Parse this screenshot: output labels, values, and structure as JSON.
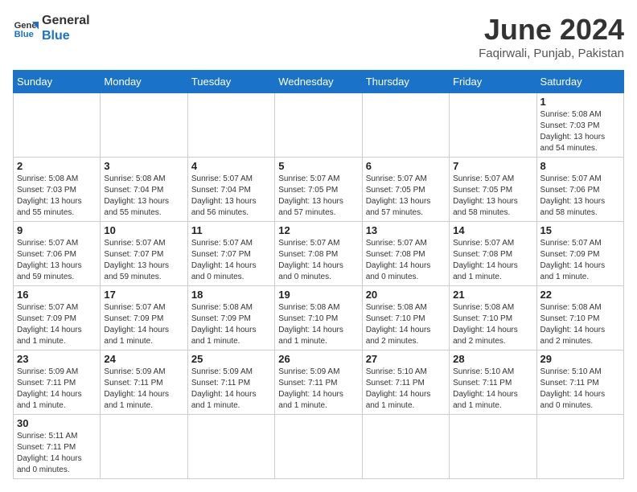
{
  "header": {
    "logo_general": "General",
    "logo_blue": "Blue",
    "title": "June 2024",
    "subtitle": "Faqirwali, Punjab, Pakistan"
  },
  "weekdays": [
    "Sunday",
    "Monday",
    "Tuesday",
    "Wednesday",
    "Thursday",
    "Friday",
    "Saturday"
  ],
  "weeks": [
    [
      {
        "day": "",
        "info": ""
      },
      {
        "day": "",
        "info": ""
      },
      {
        "day": "",
        "info": ""
      },
      {
        "day": "",
        "info": ""
      },
      {
        "day": "",
        "info": ""
      },
      {
        "day": "",
        "info": ""
      },
      {
        "day": "1",
        "info": "Sunrise: 5:08 AM\nSunset: 7:03 PM\nDaylight: 13 hours\nand 54 minutes."
      }
    ],
    [
      {
        "day": "2",
        "info": "Sunrise: 5:08 AM\nSunset: 7:03 PM\nDaylight: 13 hours\nand 55 minutes."
      },
      {
        "day": "3",
        "info": "Sunrise: 5:08 AM\nSunset: 7:04 PM\nDaylight: 13 hours\nand 55 minutes."
      },
      {
        "day": "4",
        "info": "Sunrise: 5:07 AM\nSunset: 7:04 PM\nDaylight: 13 hours\nand 56 minutes."
      },
      {
        "day": "5",
        "info": "Sunrise: 5:07 AM\nSunset: 7:05 PM\nDaylight: 13 hours\nand 57 minutes."
      },
      {
        "day": "6",
        "info": "Sunrise: 5:07 AM\nSunset: 7:05 PM\nDaylight: 13 hours\nand 57 minutes."
      },
      {
        "day": "7",
        "info": "Sunrise: 5:07 AM\nSunset: 7:05 PM\nDaylight: 13 hours\nand 58 minutes."
      },
      {
        "day": "8",
        "info": "Sunrise: 5:07 AM\nSunset: 7:06 PM\nDaylight: 13 hours\nand 58 minutes."
      }
    ],
    [
      {
        "day": "9",
        "info": "Sunrise: 5:07 AM\nSunset: 7:06 PM\nDaylight: 13 hours\nand 59 minutes."
      },
      {
        "day": "10",
        "info": "Sunrise: 5:07 AM\nSunset: 7:07 PM\nDaylight: 13 hours\nand 59 minutes."
      },
      {
        "day": "11",
        "info": "Sunrise: 5:07 AM\nSunset: 7:07 PM\nDaylight: 14 hours\nand 0 minutes."
      },
      {
        "day": "12",
        "info": "Sunrise: 5:07 AM\nSunset: 7:08 PM\nDaylight: 14 hours\nand 0 minutes."
      },
      {
        "day": "13",
        "info": "Sunrise: 5:07 AM\nSunset: 7:08 PM\nDaylight: 14 hours\nand 0 minutes."
      },
      {
        "day": "14",
        "info": "Sunrise: 5:07 AM\nSunset: 7:08 PM\nDaylight: 14 hours\nand 1 minute."
      },
      {
        "day": "15",
        "info": "Sunrise: 5:07 AM\nSunset: 7:09 PM\nDaylight: 14 hours\nand 1 minute."
      }
    ],
    [
      {
        "day": "16",
        "info": "Sunrise: 5:07 AM\nSunset: 7:09 PM\nDaylight: 14 hours\nand 1 minute."
      },
      {
        "day": "17",
        "info": "Sunrise: 5:07 AM\nSunset: 7:09 PM\nDaylight: 14 hours\nand 1 minute."
      },
      {
        "day": "18",
        "info": "Sunrise: 5:08 AM\nSunset: 7:09 PM\nDaylight: 14 hours\nand 1 minute."
      },
      {
        "day": "19",
        "info": "Sunrise: 5:08 AM\nSunset: 7:10 PM\nDaylight: 14 hours\nand 1 minute."
      },
      {
        "day": "20",
        "info": "Sunrise: 5:08 AM\nSunset: 7:10 PM\nDaylight: 14 hours\nand 2 minutes."
      },
      {
        "day": "21",
        "info": "Sunrise: 5:08 AM\nSunset: 7:10 PM\nDaylight: 14 hours\nand 2 minutes."
      },
      {
        "day": "22",
        "info": "Sunrise: 5:08 AM\nSunset: 7:10 PM\nDaylight: 14 hours\nand 2 minutes."
      }
    ],
    [
      {
        "day": "23",
        "info": "Sunrise: 5:09 AM\nSunset: 7:11 PM\nDaylight: 14 hours\nand 1 minute."
      },
      {
        "day": "24",
        "info": "Sunrise: 5:09 AM\nSunset: 7:11 PM\nDaylight: 14 hours\nand 1 minute."
      },
      {
        "day": "25",
        "info": "Sunrise: 5:09 AM\nSunset: 7:11 PM\nDaylight: 14 hours\nand 1 minute."
      },
      {
        "day": "26",
        "info": "Sunrise: 5:09 AM\nSunset: 7:11 PM\nDaylight: 14 hours\nand 1 minute."
      },
      {
        "day": "27",
        "info": "Sunrise: 5:10 AM\nSunset: 7:11 PM\nDaylight: 14 hours\nand 1 minute."
      },
      {
        "day": "28",
        "info": "Sunrise: 5:10 AM\nSunset: 7:11 PM\nDaylight: 14 hours\nand 1 minute."
      },
      {
        "day": "29",
        "info": "Sunrise: 5:10 AM\nSunset: 7:11 PM\nDaylight: 14 hours\nand 0 minutes."
      }
    ],
    [
      {
        "day": "30",
        "info": "Sunrise: 5:11 AM\nSunset: 7:11 PM\nDaylight: 14 hours\nand 0 minutes."
      },
      {
        "day": "",
        "info": ""
      },
      {
        "day": "",
        "info": ""
      },
      {
        "day": "",
        "info": ""
      },
      {
        "day": "",
        "info": ""
      },
      {
        "day": "",
        "info": ""
      },
      {
        "day": "",
        "info": ""
      }
    ]
  ]
}
